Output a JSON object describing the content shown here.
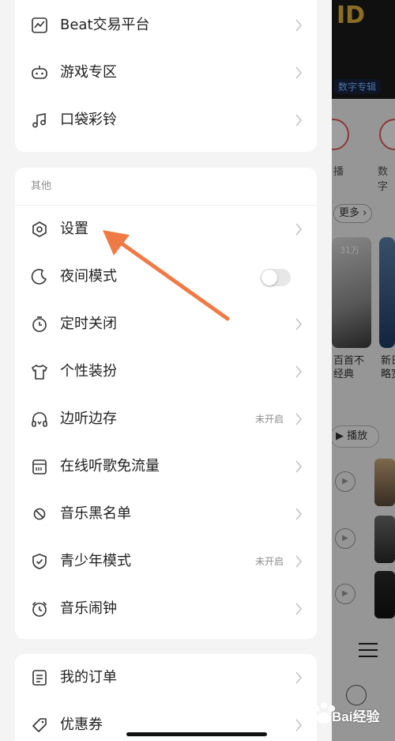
{
  "drawer": {
    "top_card": {
      "items": [
        {
          "label": "Beat交易平台",
          "icon": "trend-chart-icon"
        },
        {
          "label": "游戏专区",
          "icon": "game-robot-icon"
        },
        {
          "label": "口袋彩铃",
          "icon": "music-note-icon"
        }
      ]
    },
    "other_card": {
      "title": "其他",
      "items": [
        {
          "label": "设置",
          "icon": "settings-hexagon-icon"
        },
        {
          "label": "夜间模式",
          "icon": "moon-icon",
          "toggle": false
        },
        {
          "label": "定时关闭",
          "icon": "timer-icon"
        },
        {
          "label": "个性装扮",
          "icon": "tshirt-icon"
        },
        {
          "label": "边听边存",
          "icon": "headphones-icon",
          "status": "未开启"
        },
        {
          "label": "在线听歌免流量",
          "icon": "sim-card-icon"
        },
        {
          "label": "音乐黑名单",
          "icon": "block-icon"
        },
        {
          "label": "青少年模式",
          "icon": "shield-check-icon",
          "status": "未开启"
        },
        {
          "label": "音乐闹钟",
          "icon": "alarm-clock-icon"
        }
      ]
    },
    "bottom_card": {
      "items": [
        {
          "label": "我的订单",
          "icon": "order-document-icon"
        },
        {
          "label": "优惠券",
          "icon": "coupon-icon"
        }
      ]
    }
  },
  "background": {
    "banner_letters": "ID",
    "banner_tag": "数字专辑",
    "shortcut_labels": [
      "播",
      "数字"
    ],
    "more_button": "更多",
    "photo_badge": "31万",
    "captions": [
      "百首不\n经典",
      "新日\n略宽"
    ],
    "play_all": "播放"
  },
  "watermark": "Bai经验",
  "colors": {
    "arrow": "#f07a45",
    "accent_red": "#e25b5b"
  }
}
